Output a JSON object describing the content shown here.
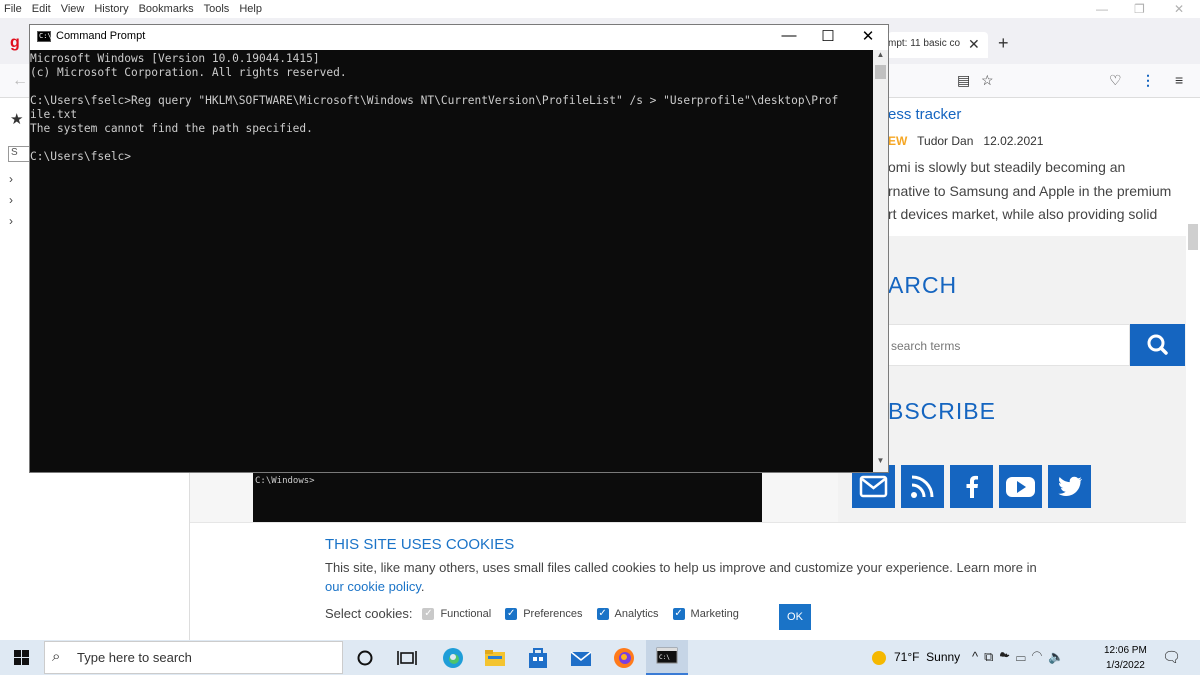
{
  "firefox": {
    "menu": [
      "File",
      "Edit",
      "View",
      "History",
      "Bookmarks",
      "Tools",
      "Help"
    ],
    "tab_title": "mpt: 11 basic co",
    "sidebar_search_placeholder": "S"
  },
  "article": {
    "title": "ess tracker",
    "badge": "EW",
    "author": "Tudor Dan",
    "date": "12.02.2021",
    "body_lines": [
      "omi is slowly but steadily becoming an",
      "rnative to Samsung and Apple in the premium",
      "rt devices market, while also providing solid"
    ]
  },
  "search_widget": {
    "heading": "ARCH",
    "placeholder": "search terms"
  },
  "subscribe": {
    "heading": "BSCRIBE",
    "icons": [
      "email-icon",
      "rss-icon",
      "facebook-icon",
      "youtube-icon",
      "twitter-icon"
    ]
  },
  "embedded_cmd": {
    "prompt": "C:\\Windows>"
  },
  "cookie": {
    "title": "THIS SITE USES COOKIES",
    "text": "This site, like many others, uses small files called cookies to help us improve and customize your experience. Learn more in",
    "link": "our cookie policy",
    "after_link": ".",
    "select_label": "Select cookies:",
    "options": [
      {
        "label": "Functional",
        "checked": true,
        "disabled": true
      },
      {
        "label": "Preferences",
        "checked": true,
        "disabled": false
      },
      {
        "label": "Analytics",
        "checked": true,
        "disabled": false
      },
      {
        "label": "Marketing",
        "checked": true,
        "disabled": false
      }
    ],
    "ok_label": "OK"
  },
  "cmd": {
    "title": "Command Prompt",
    "lines": [
      "Microsoft Windows [Version 10.0.19044.1415]",
      "(c) Microsoft Corporation. All rights reserved.",
      "",
      "C:\\Users\\fselc>Reg query \"HKLM\\SOFTWARE\\Microsoft\\Windows NT\\CurrentVersion\\ProfileList\" /s > \"Userprofile\"\\desktop\\Prof",
      "ile.txt",
      "The system cannot find the path specified.",
      "",
      "C:\\Users\\fselc>"
    ]
  },
  "taskbar": {
    "search_placeholder": "Type here to search",
    "weather_temp": "71°F",
    "weather_text": "Sunny",
    "time": "12:06 PM",
    "date": "1/3/2022",
    "apps": [
      "cortana-icon",
      "task-view-icon",
      "edge-icon",
      "file-explorer-icon",
      "store-icon",
      "mail-icon",
      "firefox-icon",
      "cmd-icon"
    ]
  },
  "colors": {
    "accent": "#1565c0",
    "console_bg": "#0c0c0c",
    "console_fg": "#cccccc",
    "taskbar_bg": "#dfe9f3"
  }
}
